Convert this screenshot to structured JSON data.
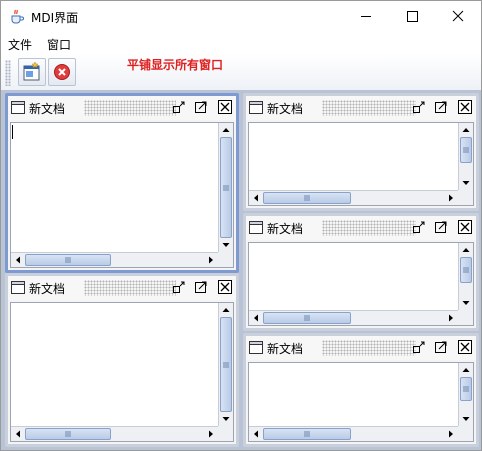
{
  "window": {
    "title": "MDI界面"
  },
  "menu": {
    "items": [
      "文件",
      "窗口"
    ]
  },
  "toolbar": {
    "tile_label": "平铺显示所有窗口",
    "label_color": "#e02020"
  },
  "frames": [
    {
      "title": "新文档",
      "selected": true
    },
    {
      "title": "新文档",
      "selected": false
    },
    {
      "title": "新文档",
      "selected": false
    },
    {
      "title": "新文档",
      "selected": false
    },
    {
      "title": "新文档",
      "selected": false
    }
  ],
  "colors": {
    "desktop": "#b8c4d5",
    "selected_border": "#7e9ad0"
  },
  "icons": [
    "java-cup-icon",
    "minimize-icon",
    "maximize-icon",
    "close-icon",
    "new-document-icon",
    "stop-close-icon",
    "frame-icon",
    "iconify-icon",
    "frame-maximize-icon",
    "frame-close-icon"
  ]
}
